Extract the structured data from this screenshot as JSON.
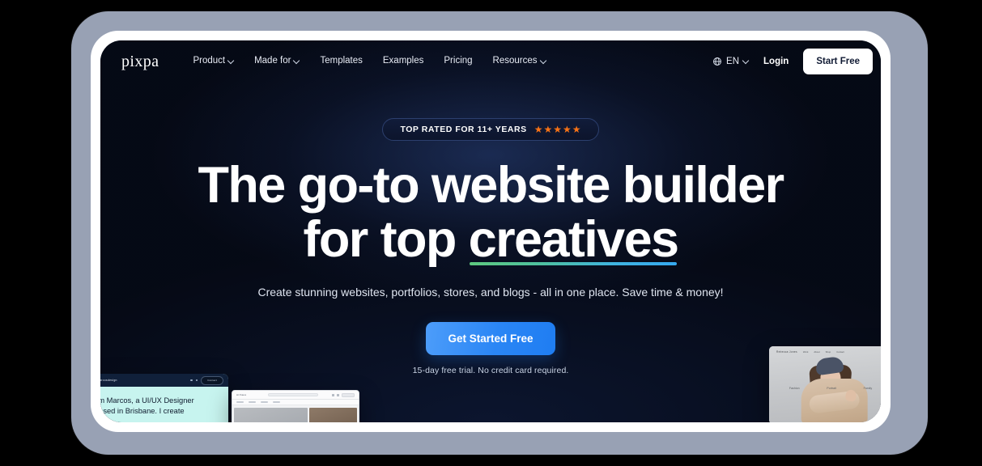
{
  "site": {
    "logo": "pixpa"
  },
  "nav": {
    "links": [
      {
        "label": "Product",
        "has_chevron": true
      },
      {
        "label": "Made for",
        "has_chevron": true
      },
      {
        "label": "Templates",
        "has_chevron": false
      },
      {
        "label": "Examples",
        "has_chevron": false
      },
      {
        "label": "Pricing",
        "has_chevron": false
      },
      {
        "label": "Resources",
        "has_chevron": true
      }
    ],
    "language": {
      "icon": "globe-icon",
      "label": "EN",
      "has_chevron": true
    },
    "login_label": "Login",
    "start_free_label": "Start Free"
  },
  "hero": {
    "badge": {
      "text": "TOP RATED FOR 11+ YEARS",
      "stars": 5,
      "star_glyph": "★",
      "star_color": "#f97316",
      "border_color": "#2c3f6e"
    },
    "headline_line1": "The go-to website builder",
    "headline_line2_prefix": "for top ",
    "headline_accent": "creatives",
    "accent_underline_colors": [
      "#5ec97f",
      "#35a9f0"
    ],
    "subheadline": "Create stunning websites, portfolios, stores, and blogs - all in one place. Save time & money!",
    "cta_label": "Get Started Free",
    "cta_color": "#2a86f5",
    "cta_note": "15-day free trial. No credit card required."
  },
  "showcase": {
    "left_card": {
      "brand": "marcosdesign",
      "menu_button": "Contact",
      "line1": "I'm Marcos, a UI/UX Designer",
      "line2": "based in Brisbane. I create",
      "background": "#c7f4ef"
    },
    "middle_card": {
      "brand": "Arthaus",
      "background": "#f2f3f5"
    },
    "right_card": {
      "brand": "Rebecca Jones",
      "nav": [
        "Work",
        "About",
        "Shop",
        "Contact"
      ],
      "categories": [
        "Fashion",
        "Portrait",
        "Family"
      ],
      "background": "#cfd1d3"
    }
  },
  "frame": {
    "outer_background": "#000000",
    "device_color": "#98a1b4",
    "bezel_color": "#ffffff",
    "page_background": "#0a1126"
  }
}
